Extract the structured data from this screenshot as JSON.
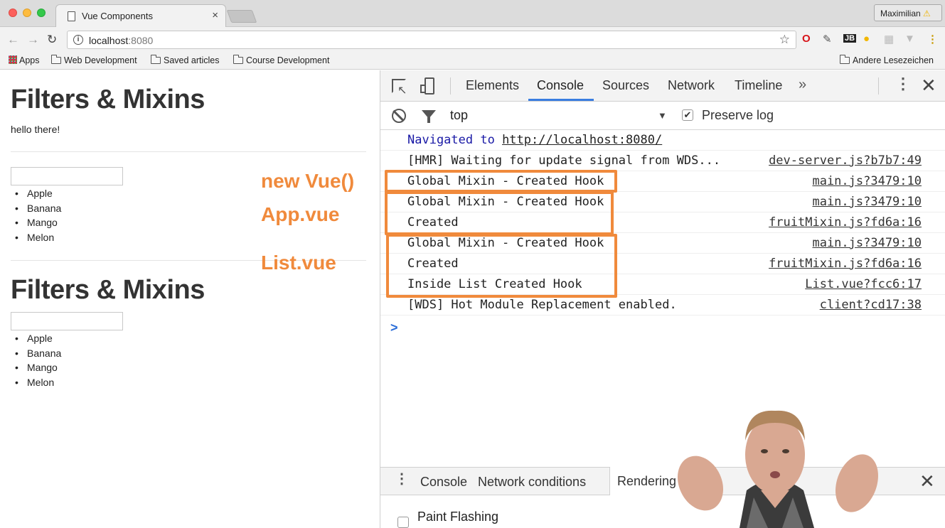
{
  "browser": {
    "tab_title": "Vue Components",
    "tab_close": "×",
    "profile_name": "Maximilian",
    "profile_warning": "⚠",
    "url_host": "localhost",
    "url_port": ":8080",
    "bookmarks": [
      "Apps",
      "Web Development",
      "Saved articles",
      "Course Development"
    ],
    "other_bookmarks": "Andere Lesezeichen"
  },
  "page": {
    "sections": [
      {
        "title": "Filters & Mixins",
        "text": "hello there!",
        "fruits": [
          "Apple",
          "Banana",
          "Mango",
          "Melon"
        ]
      },
      {
        "title": "Filters & Mixins",
        "fruits": [
          "Apple",
          "Banana",
          "Mango",
          "Melon"
        ]
      }
    ]
  },
  "annotations": {
    "new_vue": "new Vue()",
    "app_vue": "App.vue",
    "list_vue": "List.vue",
    "accent_color": "#f08a3c"
  },
  "devtools": {
    "tabs": [
      "Elements",
      "Console",
      "Sources",
      "Network",
      "Timeline"
    ],
    "active_tab": "Console",
    "more_tabs": "»",
    "context": "top",
    "preserve_log_label": "Preserve log",
    "preserve_log_checked": true,
    "console_rows": [
      {
        "message": "Navigated to ",
        "link": "http://localhost:8080/",
        "source": ""
      },
      {
        "message": "[HMR] Waiting for update signal from WDS...",
        "source": "dev-server.js?b7b7:49"
      },
      {
        "message": "Global Mixin - Created Hook",
        "source": "main.js?3479:10"
      },
      {
        "message": "Global Mixin - Created Hook",
        "source": "main.js?3479:10"
      },
      {
        "message": "Created",
        "source": "fruitMixin.js?fd6a:16"
      },
      {
        "message": "Global Mixin - Created Hook",
        "source": "main.js?3479:10"
      },
      {
        "message": "Created",
        "source": "fruitMixin.js?fd6a:16"
      },
      {
        "message": "Inside List Created Hook",
        "source": "List.vue?fcc6:17"
      },
      {
        "message": "[WDS] Hot Module Replacement enabled.",
        "source": "client?cd17:38"
      }
    ],
    "prompt": ">",
    "drawer_tabs": [
      "Console",
      "Network conditions",
      "Rendering"
    ],
    "drawer_active": "Rendering",
    "paint_flashing_label": "Paint Flashing",
    "close_glyph": "✕"
  }
}
